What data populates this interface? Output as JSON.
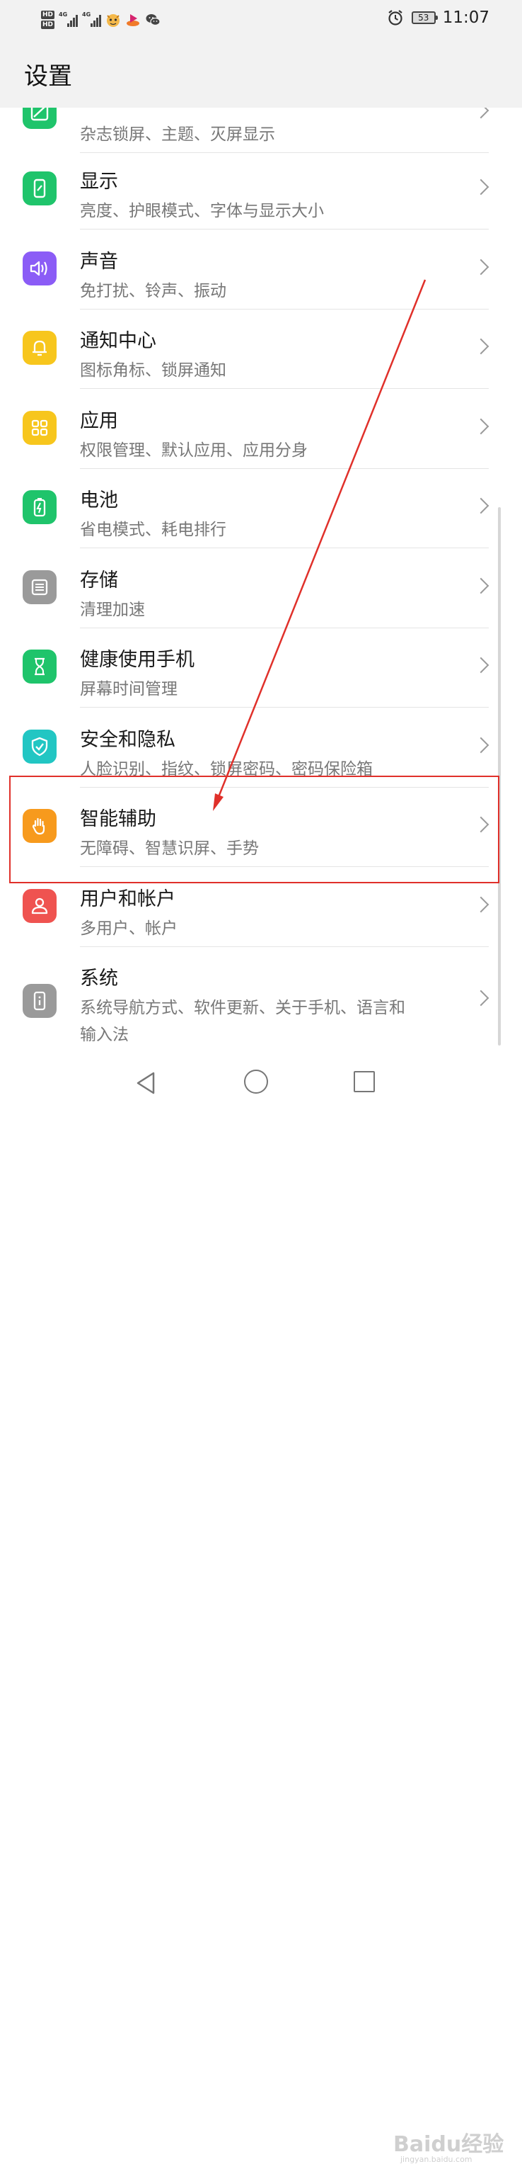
{
  "status_bar": {
    "hd1": "HD",
    "hd2": "HD",
    "net1": "4G",
    "net2": "4G",
    "battery_level": "53",
    "time": "11:07"
  },
  "header": {
    "title": "设置"
  },
  "settings_items": [
    {
      "title": "",
      "subtitle": "杂志锁屏、主题、灭屏显示",
      "icon": "wallpaper-icon",
      "color": "#1fc46b"
    },
    {
      "title": "显示",
      "subtitle": "亮度、护眼模式、字体与显示大小",
      "icon": "display-icon",
      "color": "#1fc46b"
    },
    {
      "title": "声音",
      "subtitle": "免打扰、铃声、振动",
      "icon": "sound-icon",
      "color": "#8b5cf6"
    },
    {
      "title": "通知中心",
      "subtitle": "图标角标、锁屏通知",
      "icon": "bell-icon",
      "color": "#f7c61d"
    },
    {
      "title": "应用",
      "subtitle": "权限管理、默认应用、应用分身",
      "icon": "apps-grid-icon",
      "color": "#f7c61d"
    },
    {
      "title": "电池",
      "subtitle": "省电模式、耗电排行",
      "icon": "battery-icon",
      "color": "#1fc46b"
    },
    {
      "title": "存储",
      "subtitle": "清理加速",
      "icon": "storage-icon",
      "color": "#9a9a9a"
    },
    {
      "title": "健康使用手机",
      "subtitle": "屏幕时间管理",
      "icon": "hourglass-icon",
      "color": "#1fc46b"
    },
    {
      "title": "安全和隐私",
      "subtitle": "人脸识别、指纹、锁屏密码、密码保险箱",
      "icon": "shield-icon",
      "color": "#22c6c3"
    },
    {
      "title": "智能辅助",
      "subtitle": "无障碍、智慧识屏、手势",
      "icon": "hand-icon",
      "color": "#f79a1d"
    },
    {
      "title": "用户和帐户",
      "subtitle": "多用户、帐户",
      "icon": "user-icon",
      "color": "#ef5350"
    },
    {
      "title": "系统",
      "subtitle": "系统导航方式、软件更新、关于手机、语言和",
      "subtitle2": "输入法",
      "icon": "phone-info-icon",
      "color": "#9a9a9a"
    }
  ],
  "watermark": {
    "text": "Baidu经验",
    "sub": "jingyan.baidu.com"
  }
}
